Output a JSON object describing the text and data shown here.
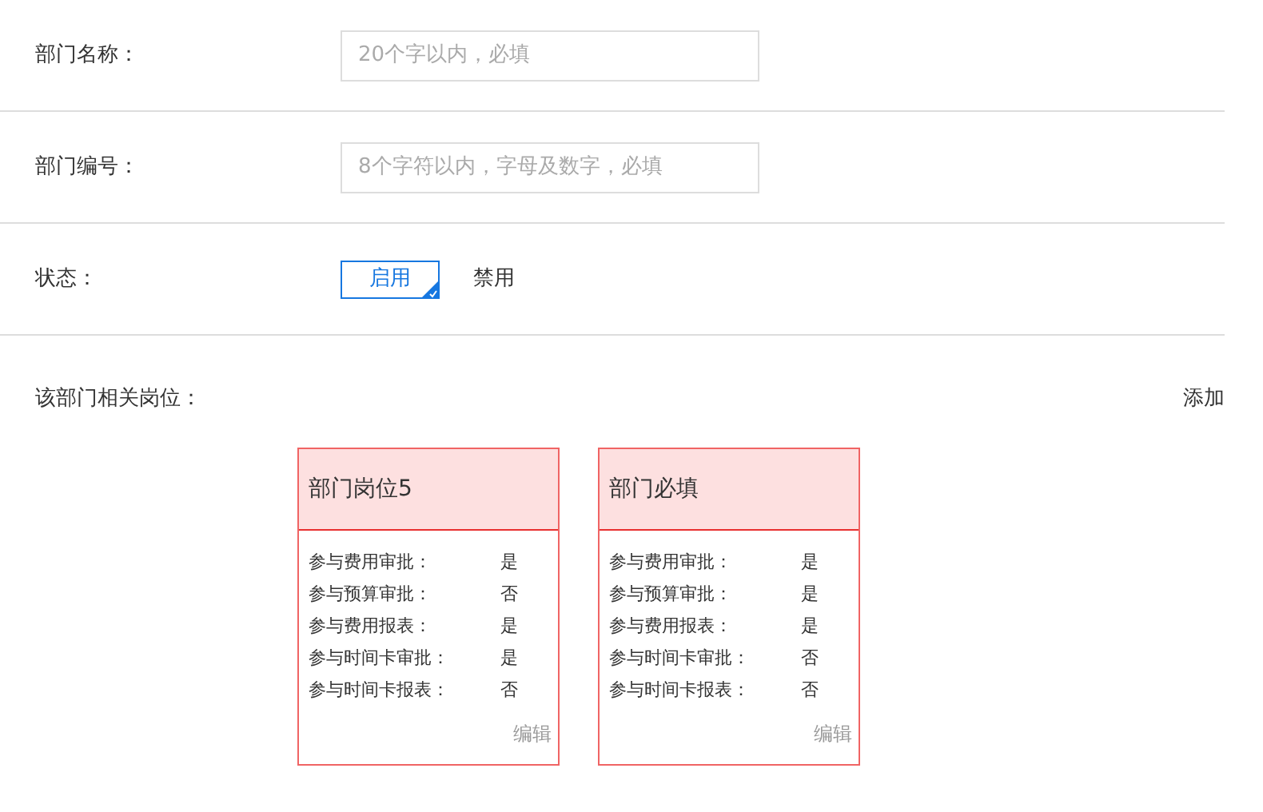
{
  "fields": [
    {
      "label": "部门名称：",
      "placeholder": "20个字以内，必填"
    },
    {
      "label": "部门编号：",
      "placeholder": "8个字符以内，字母及数字，必填"
    }
  ],
  "status": {
    "label": "状态：",
    "options": [
      {
        "label": "启用",
        "selected": true
      },
      {
        "label": "禁用",
        "selected": false
      }
    ]
  },
  "positions": {
    "label": "该部门相关岗位：",
    "add_link": "添加",
    "cards": [
      {
        "title": "部门岗位5",
        "rows": [
          {
            "name": "参与费用审批：",
            "value": "是"
          },
          {
            "name": "参与预算审批：",
            "value": "否"
          },
          {
            "name": "参与费用报表：",
            "value": "是"
          },
          {
            "name": "参与时间卡审批：",
            "value": "是"
          },
          {
            "name": "参与时间卡报表：",
            "value": "否"
          }
        ],
        "edit": "编辑"
      },
      {
        "title": "部门必填",
        "rows": [
          {
            "name": "参与费用审批：",
            "value": "是"
          },
          {
            "name": "参与预算审批：",
            "value": "是"
          },
          {
            "name": "参与费用报表：",
            "value": "是"
          },
          {
            "name": "参与时间卡审批：",
            "value": "否"
          },
          {
            "name": "参与时间卡报表：",
            "value": "否"
          }
        ],
        "edit": "编辑"
      }
    ]
  }
}
